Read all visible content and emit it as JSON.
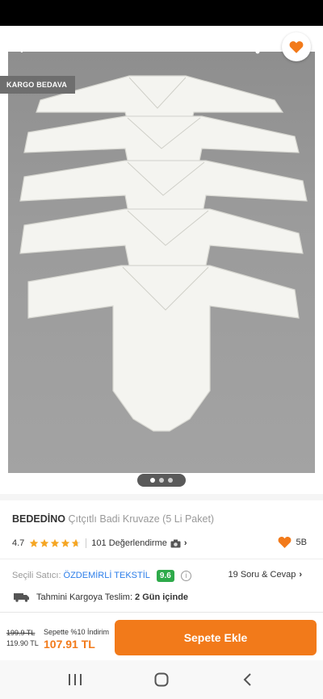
{
  "badge": {
    "label": "KARGO BEDAVA"
  },
  "gallery": {
    "current": 1,
    "total": 3
  },
  "product": {
    "brand": "BEDEDİNO",
    "name": "Çıtçıtlı Badi Kruvaze (5 Li Paket)",
    "rating": "4.7",
    "stars": 4.7,
    "reviews": "101 Değerlendirme",
    "favorites": "5B"
  },
  "seller": {
    "label": "Seçili Satıcı:",
    "name": "ÖZDEMİRLİ TEKSTİL",
    "score": "9.6",
    "qa": "19 Soru & Cevap"
  },
  "shipping": {
    "label": "Tahmini Kargoya Teslim:",
    "value": "2 Gün içinde"
  },
  "price": {
    "old": "199.9 TL",
    "mid": "119.90 TL",
    "promo": "Sepette %10 İndirim",
    "final": "107.91 TL"
  },
  "cart": {
    "label": "Sepete Ekle"
  },
  "colors": {
    "accent": "#f27a1a",
    "score": "#2eaa4a",
    "link": "#2b7de9"
  },
  "icons": [
    "back-arrow-icon",
    "share-icon",
    "heart-icon",
    "star-icon",
    "camera-icon",
    "info-icon",
    "truck-icon",
    "recent-apps-icon",
    "home-icon",
    "back-nav-icon"
  ]
}
